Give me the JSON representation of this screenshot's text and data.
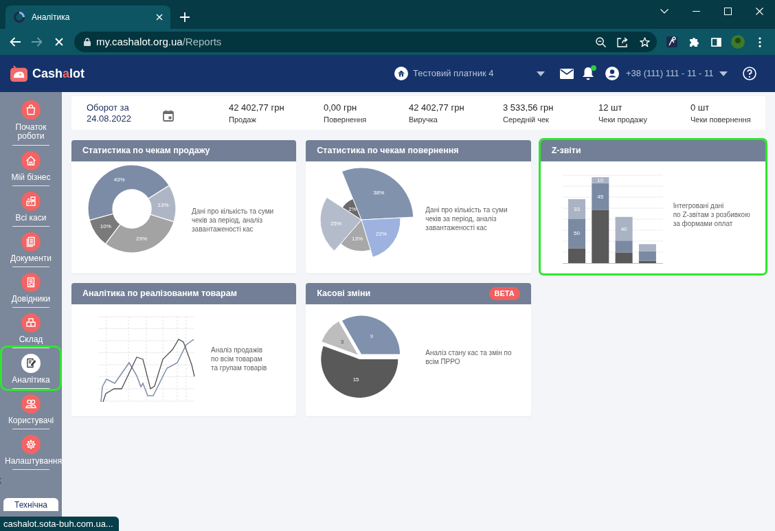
{
  "browser": {
    "tab": {
      "title": "Аналітика",
      "loading": true
    },
    "nav": {
      "forward_disabled": true
    },
    "address": {
      "host": "my.cashalot.org.ua",
      "path": "/Reports"
    },
    "status_link": "cashalot.sota-buh.com.ua..."
  },
  "app_header": {
    "logo": {
      "start": "Cash",
      "accent": "a",
      "end": "lot"
    },
    "company": "Тестовий платник 4",
    "notifications_unread": true,
    "phone": "+38 (111) 111 - 11 - 11"
  },
  "sidebar": {
    "items": [
      {
        "label": "Початок роботи",
        "selected": false,
        "highlighted": false
      },
      {
        "label": "Мій бізнес",
        "selected": false,
        "highlighted": false
      },
      {
        "label": "Всі каси",
        "selected": false,
        "highlighted": false
      },
      {
        "label": "Документи",
        "selected": false,
        "highlighted": false
      },
      {
        "label": "Довідники",
        "selected": false,
        "highlighted": false
      },
      {
        "label": "Склад",
        "selected": false,
        "highlighted": false
      },
      {
        "label": "Аналітика",
        "selected": true,
        "highlighted": true
      },
      {
        "label": "Користувачі",
        "selected": false,
        "highlighted": false
      },
      {
        "label": "Налаштування",
        "selected": false,
        "highlighted": false
      }
    ],
    "edge_text": ";",
    "support_button": "Технічна"
  },
  "summary": {
    "period_label": "Оборот за",
    "date": "24.08.2022",
    "stats": [
      {
        "value": "42 402,77 грн",
        "label": "Продаж"
      },
      {
        "value": "0,00 грн",
        "label": "Повернення"
      },
      {
        "value": "42 402,77 грн",
        "label": "Виручка"
      },
      {
        "value": "3 533,56 грн",
        "label": "Середній чек"
      },
      {
        "value": "12 шт",
        "label": "Чеки продажу"
      },
      {
        "value": "0 шт",
        "label": "Чеки повернення"
      }
    ]
  },
  "cards": [
    {
      "title": "Статистика по чекам продажу",
      "kind": "donut",
      "highlighted": false,
      "description": "Дані про кількість та суми\nчеків за період, аналіз\nзавантаженості кас",
      "chart_data": {
        "type": "donut",
        "values": [
          43,
          13,
          29,
          10
        ],
        "value_labels": [
          "43%",
          "13%",
          "29%",
          "10%"
        ]
      }
    },
    {
      "title": "Статистика по чекам повернення",
      "kind": "polar",
      "highlighted": false,
      "description": "Дані про кількість та суми\nчеків за період, аналіз\nзавантаженості кас",
      "slice_labels": [
        "38%",
        "22%",
        "13%",
        "25%",
        "2%"
      ]
    },
    {
      "title": "Z-звіти",
      "kind": "stacked_bar",
      "highlighted": true,
      "description": "Інтегровані дані\nпо Z-звітам з розбивкою\nза формами оплат",
      "chart_data": {
        "type": "bar",
        "stacked": true,
        "series": [
          {
            "color": "#595959",
            "values": [
              25,
              90,
              18,
              4
            ]
          },
          {
            "color": "#7b8aa3",
            "values": [
              50,
              45,
              20,
              16
            ],
            "value_labels": [
              "50",
              "45",
              null,
              null
            ]
          },
          {
            "color": "#a9b3c4",
            "values": [
              33,
              10,
              40,
              12
            ],
            "value_labels": [
              "33",
              "10",
              "40",
              null
            ]
          }
        ]
      }
    },
    {
      "title": "Аналітика по реалізованим товарам",
      "kind": "line",
      "highlighted": false,
      "description": "Аналіз продажів\nпо всім товарам\nта групам товарів"
    },
    {
      "title": "Касові зміни",
      "kind": "pie",
      "badge": "BETA",
      "highlighted": false,
      "description": "Аналіз стану кас та змін по\nвсім ПРРО",
      "chart_data": {
        "type": "pie",
        "values": [
          9,
          3,
          15
        ],
        "value_labels": [
          "9",
          "3",
          "15"
        ]
      }
    }
  ]
}
